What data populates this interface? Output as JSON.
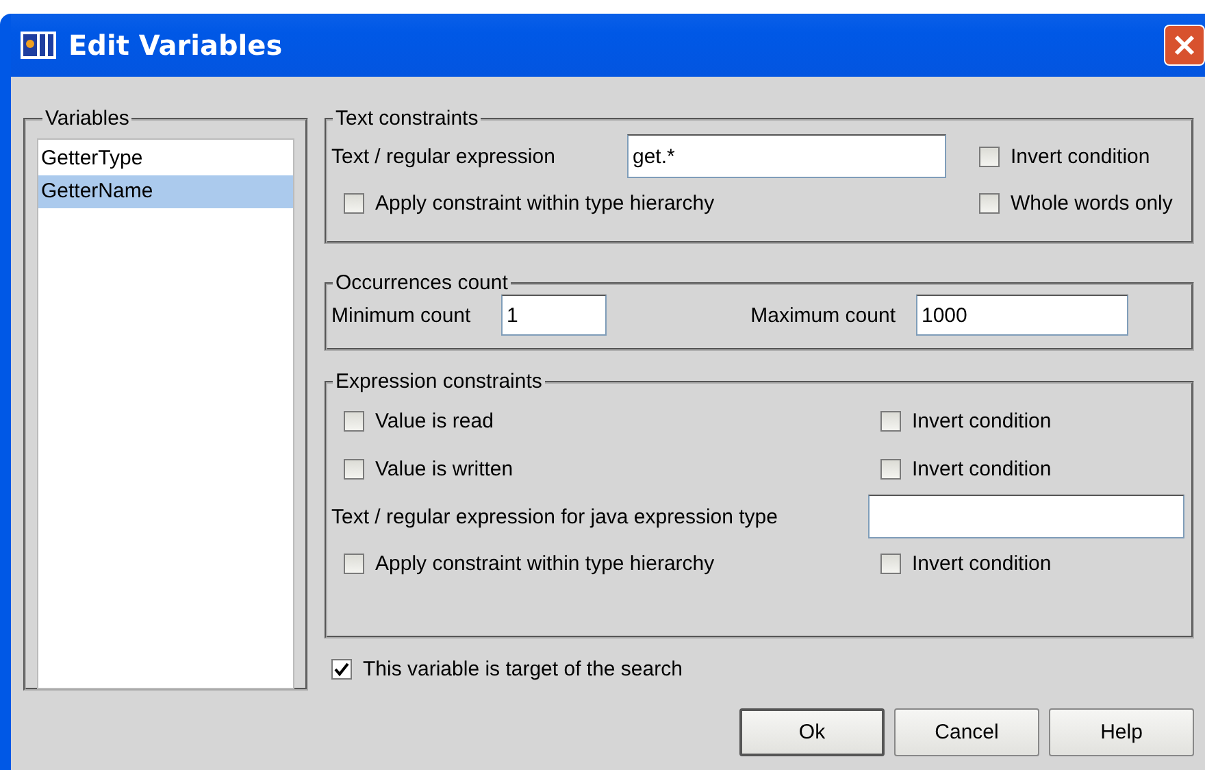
{
  "window": {
    "title": "Edit Variables"
  },
  "variables": {
    "legend": "Variables",
    "items": [
      {
        "label": "GetterType",
        "selected": false
      },
      {
        "label": "GetterName",
        "selected": true
      }
    ]
  },
  "text_constraints": {
    "legend": "Text constraints",
    "regex_label": "Text / regular expression",
    "regex_value": "get.*",
    "invert": {
      "label": "Invert condition",
      "checked": false
    },
    "apply_hierarchy": {
      "label": "Apply constraint within type hierarchy",
      "checked": false
    },
    "whole_words": {
      "label": "Whole words only",
      "checked": false
    }
  },
  "occurrences": {
    "legend": "Occurrences count",
    "min_label": "Minimum count",
    "min_value": "1",
    "max_label": "Maximum count",
    "max_value": "1000"
  },
  "expression_constraints": {
    "legend": "Expression constraints",
    "value_read": {
      "label": "Value is read",
      "checked": false
    },
    "value_read_invert": {
      "label": "Invert condition",
      "checked": false
    },
    "value_written": {
      "label": "Value is written",
      "checked": false
    },
    "value_written_invert": {
      "label": "Invert condition",
      "checked": false
    },
    "type_label": "Text / regular expression for java expression type",
    "apply_hierarchy": {
      "label": "Apply constraint within type hierarchy",
      "checked": false
    },
    "apply_hierarchy_invert": {
      "label": "Invert condition",
      "checked": false
    }
  },
  "target": {
    "label": "This variable is target of the search",
    "checked": true
  },
  "buttons": [
    {
      "label": "Ok",
      "default": true
    },
    {
      "label": "Cancel",
      "default": false
    },
    {
      "label": "Help",
      "default": false
    }
  ]
}
